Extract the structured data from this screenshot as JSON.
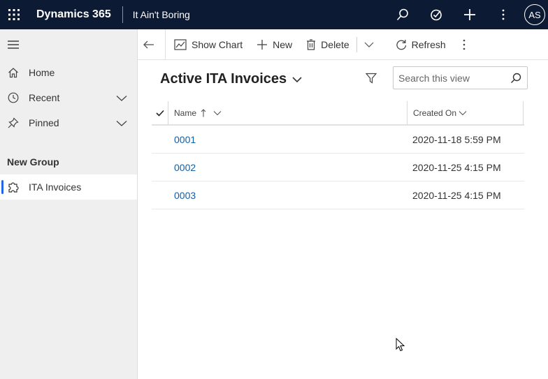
{
  "topbar": {
    "brand": "Dynamics 365",
    "app_name": "It Ain't Boring",
    "avatar_initials": "AS"
  },
  "sidebar": {
    "items": [
      {
        "label": "Home",
        "icon": "home-icon"
      },
      {
        "label": "Recent",
        "icon": "clock-icon"
      },
      {
        "label": "Pinned",
        "icon": "pin-icon"
      }
    ],
    "group_title": "New Group",
    "group_items": [
      {
        "label": "ITA Invoices",
        "icon": "puzzle-icon",
        "active": true
      }
    ]
  },
  "commandbar": {
    "show_chart": "Show Chart",
    "new": "New",
    "delete": "Delete",
    "refresh": "Refresh"
  },
  "view": {
    "title": "Active ITA Invoices",
    "search_placeholder": "Search this view"
  },
  "grid": {
    "columns": [
      "Name",
      "Created On"
    ],
    "sort": "Name ascending",
    "rows": [
      {
        "name": "0001",
        "created_on": "2020-11-18 5:59 PM"
      },
      {
        "name": "0002",
        "created_on": "2020-11-25 4:15 PM"
      },
      {
        "name": "0003",
        "created_on": "2020-11-25 4:15 PM"
      }
    ]
  },
  "colors": {
    "topbar_bg": "#0d1a33",
    "sidebar_bg": "#efefef",
    "accent": "#2266e3",
    "link": "#115ea3"
  }
}
